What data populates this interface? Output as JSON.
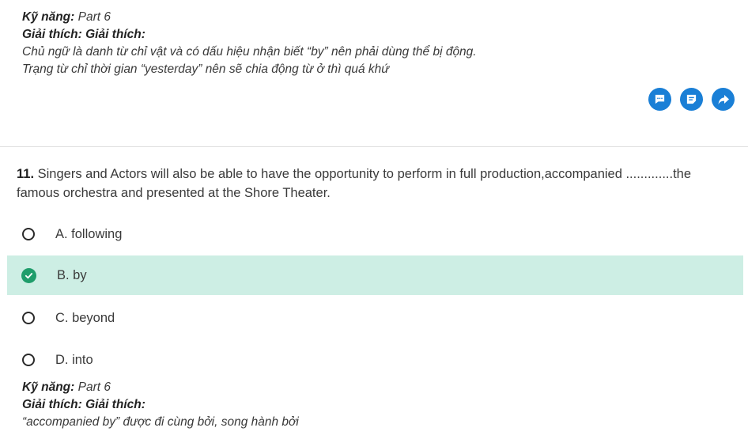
{
  "explanation_top": {
    "skill_label": "Kỹ năng:",
    "skill_value": "Part 6",
    "explain_label": "Giải thích: Giải thích:",
    "lines": [
      "Chủ ngữ là danh từ chỉ vật và có dấu hiệu nhận biết “by” nên phải dùng thể bị động.",
      "Trạng từ chỉ thời gian “yesterday” nên sẽ chia động từ ở thì quá khứ"
    ]
  },
  "actions": {
    "comment_icon": "comment-icon",
    "note_icon": "note-icon",
    "share_icon": "share-icon",
    "color": "#1a7fd6"
  },
  "question": {
    "number": "11.",
    "text": "Singers and Actors will also be able to have the opportunity to perform in full production,accompanied .............the famous orchestra and presented at the Shore Theater.",
    "options": [
      {
        "label": "A. following",
        "selected": false
      },
      {
        "label": "B. by",
        "selected": true
      },
      {
        "label": "C. beyond",
        "selected": false
      },
      {
        "label": "D. into",
        "selected": false
      }
    ],
    "selected_color": "#cdeee4",
    "check_color": "#1f9d6b"
  },
  "explanation_bottom": {
    "skill_label": "Kỹ năng:",
    "skill_value": "Part 6",
    "explain_label": "Giải thích: Giải thích:",
    "lines": [
      "“accompanied by” được đi cùng bởi, song hành bởi"
    ]
  }
}
